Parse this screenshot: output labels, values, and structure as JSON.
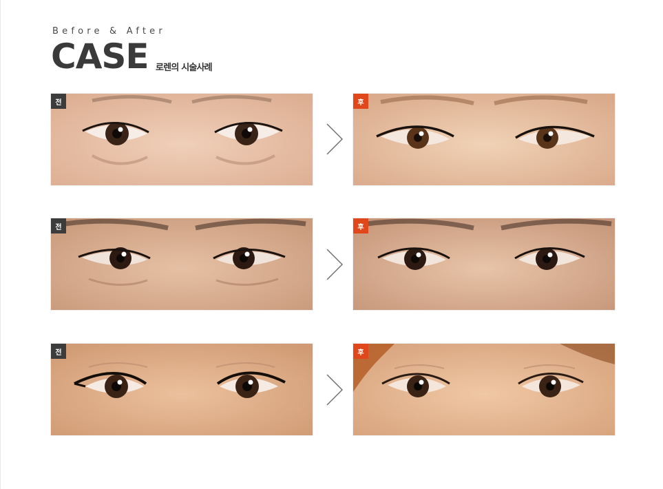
{
  "header": {
    "kicker": "Before & After",
    "title": "CASE",
    "subtitle": "로렌의 시술사례"
  },
  "cases": [
    {
      "before_badge": "전",
      "after_badge": "후",
      "before_skin": "#e9c4ad",
      "after_skin": "#eac7a8"
    },
    {
      "before_badge": "전",
      "after_badge": "후",
      "before_skin": "#dab296",
      "after_skin": "#ddb49a"
    },
    {
      "before_badge": "전",
      "after_badge": "후",
      "before_skin": "#e0b08c",
      "after_skin": "#e6b894"
    }
  ],
  "colors": {
    "before_badge_bg": "#3c3c3c",
    "after_badge_bg": "#e0481c",
    "arrow": "#6b6b6b"
  },
  "icons": {
    "arrow": "chevron-right-icon"
  }
}
